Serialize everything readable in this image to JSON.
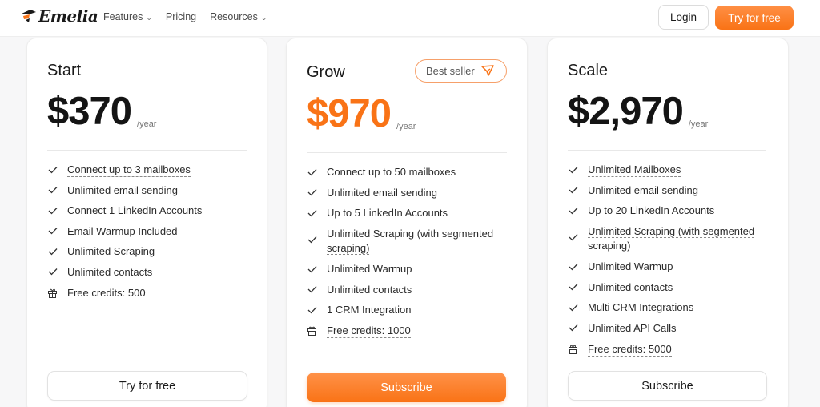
{
  "brand": {
    "name": "Emelia",
    "accent": "#f97316"
  },
  "nav": {
    "items": [
      {
        "label": "Features",
        "has_dropdown": true
      },
      {
        "label": "Pricing",
        "has_dropdown": false
      },
      {
        "label": "Resources",
        "has_dropdown": true
      }
    ],
    "dropdown_icon": "chevron-down-icon"
  },
  "header": {
    "login_label": "Login",
    "try_label": "Try for free"
  },
  "plans": [
    {
      "name": "Start",
      "price": "$370",
      "period": "/year",
      "cta": "Try for free",
      "features": [
        {
          "text": "Connect up to 3 mailboxes",
          "icon": "check-icon",
          "dotted": true
        },
        {
          "text": "Unlimited email sending",
          "icon": "check-icon",
          "dotted": false
        },
        {
          "text": "Connect 1 LinkedIn Accounts",
          "icon": "check-icon",
          "dotted": false
        },
        {
          "text": "Email Warmup Included",
          "icon": "check-icon",
          "dotted": false
        },
        {
          "text": "Unlimited Scraping",
          "icon": "check-icon",
          "dotted": false
        },
        {
          "text": "Unlimited contacts",
          "icon": "check-icon",
          "dotted": false
        },
        {
          "text": "Free credits: 500",
          "icon": "gift-icon",
          "dotted": true
        }
      ]
    },
    {
      "name": "Grow",
      "badge": "Best seller",
      "badge_icon": "rocket-icon",
      "price": "$970",
      "period": "/year",
      "cta": "Subscribe",
      "features": [
        {
          "text": "Connect up to 50 mailboxes",
          "icon": "check-icon",
          "dotted": true
        },
        {
          "text": "Unlimited email sending",
          "icon": "check-icon",
          "dotted": false
        },
        {
          "text": "Up to 5 LinkedIn Accounts",
          "icon": "check-icon",
          "dotted": false
        },
        {
          "text_line1": "Unlimited Scraping (with segmented",
          "text_line2": "scraping)",
          "icon": "check-icon",
          "dotted": true
        },
        {
          "text": "Unlimited Warmup",
          "icon": "check-icon",
          "dotted": false
        },
        {
          "text": "Unlimited contacts",
          "icon": "check-icon",
          "dotted": false
        },
        {
          "text": "1 CRM Integration",
          "icon": "check-icon",
          "dotted": false
        },
        {
          "text": "Free credits: 1000",
          "icon": "gift-icon",
          "dotted": true
        }
      ]
    },
    {
      "name": "Scale",
      "price": "$2,970",
      "period": "/year",
      "cta": "Subscribe",
      "features": [
        {
          "text": "Unlimited Mailboxes",
          "icon": "check-icon",
          "dotted": true
        },
        {
          "text": "Unlimited email sending",
          "icon": "check-icon",
          "dotted": false
        },
        {
          "text": "Up to 20 LinkedIn Accounts",
          "icon": "check-icon",
          "dotted": false
        },
        {
          "text_line1": "Unlimited Scraping (with segmented",
          "text_line2": "scraping)",
          "icon": "check-icon",
          "dotted": true
        },
        {
          "text": "Unlimited Warmup",
          "icon": "check-icon",
          "dotted": false
        },
        {
          "text": "Unlimited contacts",
          "icon": "check-icon",
          "dotted": false
        },
        {
          "text": "Multi CRM Integrations",
          "icon": "check-icon",
          "dotted": false
        },
        {
          "text": "Unlimited API Calls",
          "icon": "check-icon",
          "dotted": false
        },
        {
          "text": "Free credits: 5000",
          "icon": "gift-icon",
          "dotted": true
        }
      ]
    }
  ]
}
